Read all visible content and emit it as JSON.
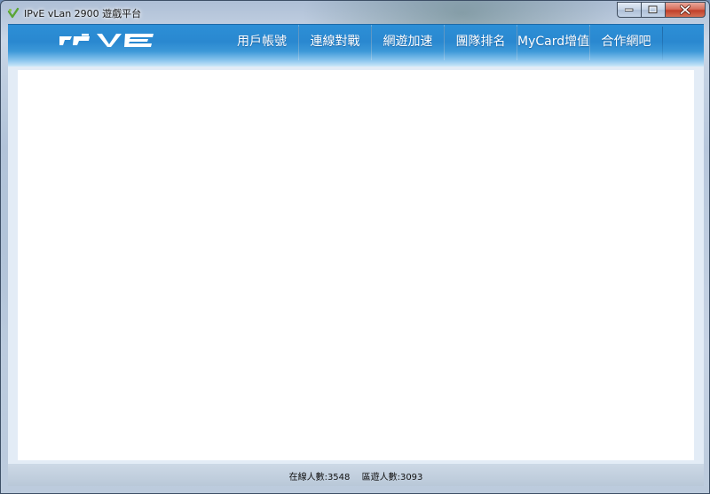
{
  "window": {
    "title": "IPvE vLan 2900 遊戲平台"
  },
  "header": {
    "logo_text": "IPVE",
    "nav": [
      {
        "label": "用戶帳號"
      },
      {
        "label": "連線對戰"
      },
      {
        "label": "網遊加速"
      },
      {
        "label": "團隊排名"
      },
      {
        "label": "MyCard增值"
      },
      {
        "label": "合作網吧"
      }
    ]
  },
  "status": {
    "online": "在線人數:3548",
    "room": "區遊人數:3093"
  },
  "colors": {
    "header_blue": "#2a88d0",
    "content_bg": "#ffffff",
    "close_red": "#c0402a"
  },
  "icons": [
    "app-icon",
    "minimize-icon",
    "maximize-icon",
    "close-icon"
  ]
}
